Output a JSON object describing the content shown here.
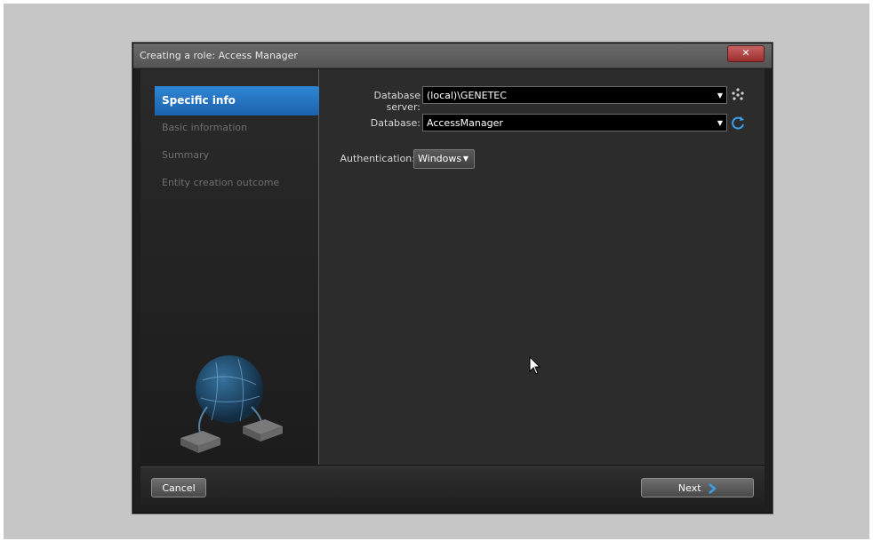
{
  "window": {
    "title": "Creating a role: Access Manager",
    "close_glyph": "✕"
  },
  "sidebar": {
    "steps": [
      {
        "label": "Specific info",
        "active": true
      },
      {
        "label": "Basic information",
        "active": false
      },
      {
        "label": "Summary",
        "active": false
      },
      {
        "label": "Entity creation outcome",
        "active": false
      }
    ]
  },
  "form": {
    "database_server": {
      "label": "Database server:",
      "value": "(local)\\GENETEC"
    },
    "database": {
      "label": "Database:",
      "value": "AccessManager"
    },
    "authentication": {
      "label": "Authentication:",
      "value": "Windows"
    }
  },
  "footer": {
    "cancel_label": "Cancel",
    "next_label": "Next"
  },
  "icons": {
    "server-discovery": "dots-icon",
    "refresh": "refresh-icon",
    "dropdown": "▼",
    "next-chevron": "chevron-right-icon"
  },
  "colors": {
    "accent": "#1f6fc1",
    "refresh_icon": "#3a9ee8",
    "close_button": "#b04444"
  }
}
